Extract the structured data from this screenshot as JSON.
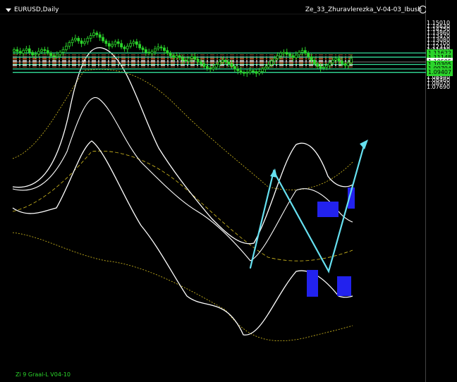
{
  "window": {
    "symbol": "EURUSD,Daily",
    "indicator": "Ze_33_Zhuravlerezka_V-04-03_Ibush",
    "footer": "Zi 9 Graal-L V04-10"
  },
  "colors": {
    "background": "#000000",
    "candles": "#2bd42b",
    "bands": "#ffffff",
    "outer_envelope": "#d8c020",
    "levels": "#33dd99",
    "zigzag": "#66e0f0",
    "boxes": "#2222ee",
    "dashed_levels": "#e07030",
    "price_tag_bg": "#2bd42b",
    "current_price_tag_bg": "#ffffff"
  },
  "chart_data": {
    "type": "candlestick",
    "symbol": "EURUSD",
    "timeframe": "Daily",
    "y_ticks": [
      1.1501,
      1.1463,
      1.1425,
      1.1386,
      1.1347,
      1.1308,
      1.127,
      1.1231,
      1.1193,
      1.1154,
      1.1077,
      1.1,
      1.0962,
      1.0923,
      1.0884,
      1.0846,
      1.0807,
      1.0769
    ],
    "ylim": [
      1.0765,
      1.153
    ],
    "horizontal_levels": [
      1.11622,
      1.11148,
      1.10305,
      1.09794,
      1.09407
    ],
    "current_price": 1.10595,
    "price_tags": [
      {
        "value": "1.11622",
        "style": "level"
      },
      {
        "value": "1.11148",
        "style": "level"
      },
      {
        "value": "1.10595",
        "style": "current"
      },
      {
        "value": "1.10305",
        "style": "level"
      },
      {
        "value": "1.09794",
        "style": "level"
      },
      {
        "value": "1.09407",
        "style": "level"
      }
    ],
    "close_series": [
      1.12,
      1.118,
      1.116,
      1.119,
      1.121,
      1.117,
      1.114,
      1.115,
      1.118,
      1.12,
      1.119,
      1.116,
      1.113,
      1.112,
      1.114,
      1.117,
      1.12,
      1.124,
      1.128,
      1.131,
      1.133,
      1.13,
      1.127,
      1.129,
      1.133,
      1.136,
      1.139,
      1.137,
      1.134,
      1.13,
      1.127,
      1.124,
      1.126,
      1.129,
      1.127,
      1.123,
      1.121,
      1.124,
      1.127,
      1.129,
      1.126,
      1.122,
      1.12,
      1.117,
      1.116,
      1.118,
      1.121,
      1.123,
      1.122,
      1.119,
      1.116,
      1.113,
      1.111,
      1.113,
      1.111,
      1.108,
      1.107,
      1.11,
      1.112,
      1.109,
      1.106,
      1.104,
      1.101,
      1.099,
      1.098,
      1.1,
      1.103,
      1.106,
      1.108,
      1.106,
      1.104,
      1.101,
      1.098,
      1.096,
      1.094,
      1.093,
      1.094,
      1.096,
      1.095,
      1.093,
      1.095,
      1.098,
      1.1,
      1.103,
      1.107,
      1.11,
      1.113,
      1.116,
      1.117,
      1.115,
      1.113,
      1.111,
      1.114,
      1.117,
      1.119,
      1.116,
      1.112,
      1.108,
      1.104,
      1.101,
      1.099,
      1.1,
      1.102,
      1.105,
      1.108,
      1.11,
      1.107,
      1.104,
      1.102,
      1.105,
      1.11
    ]
  }
}
